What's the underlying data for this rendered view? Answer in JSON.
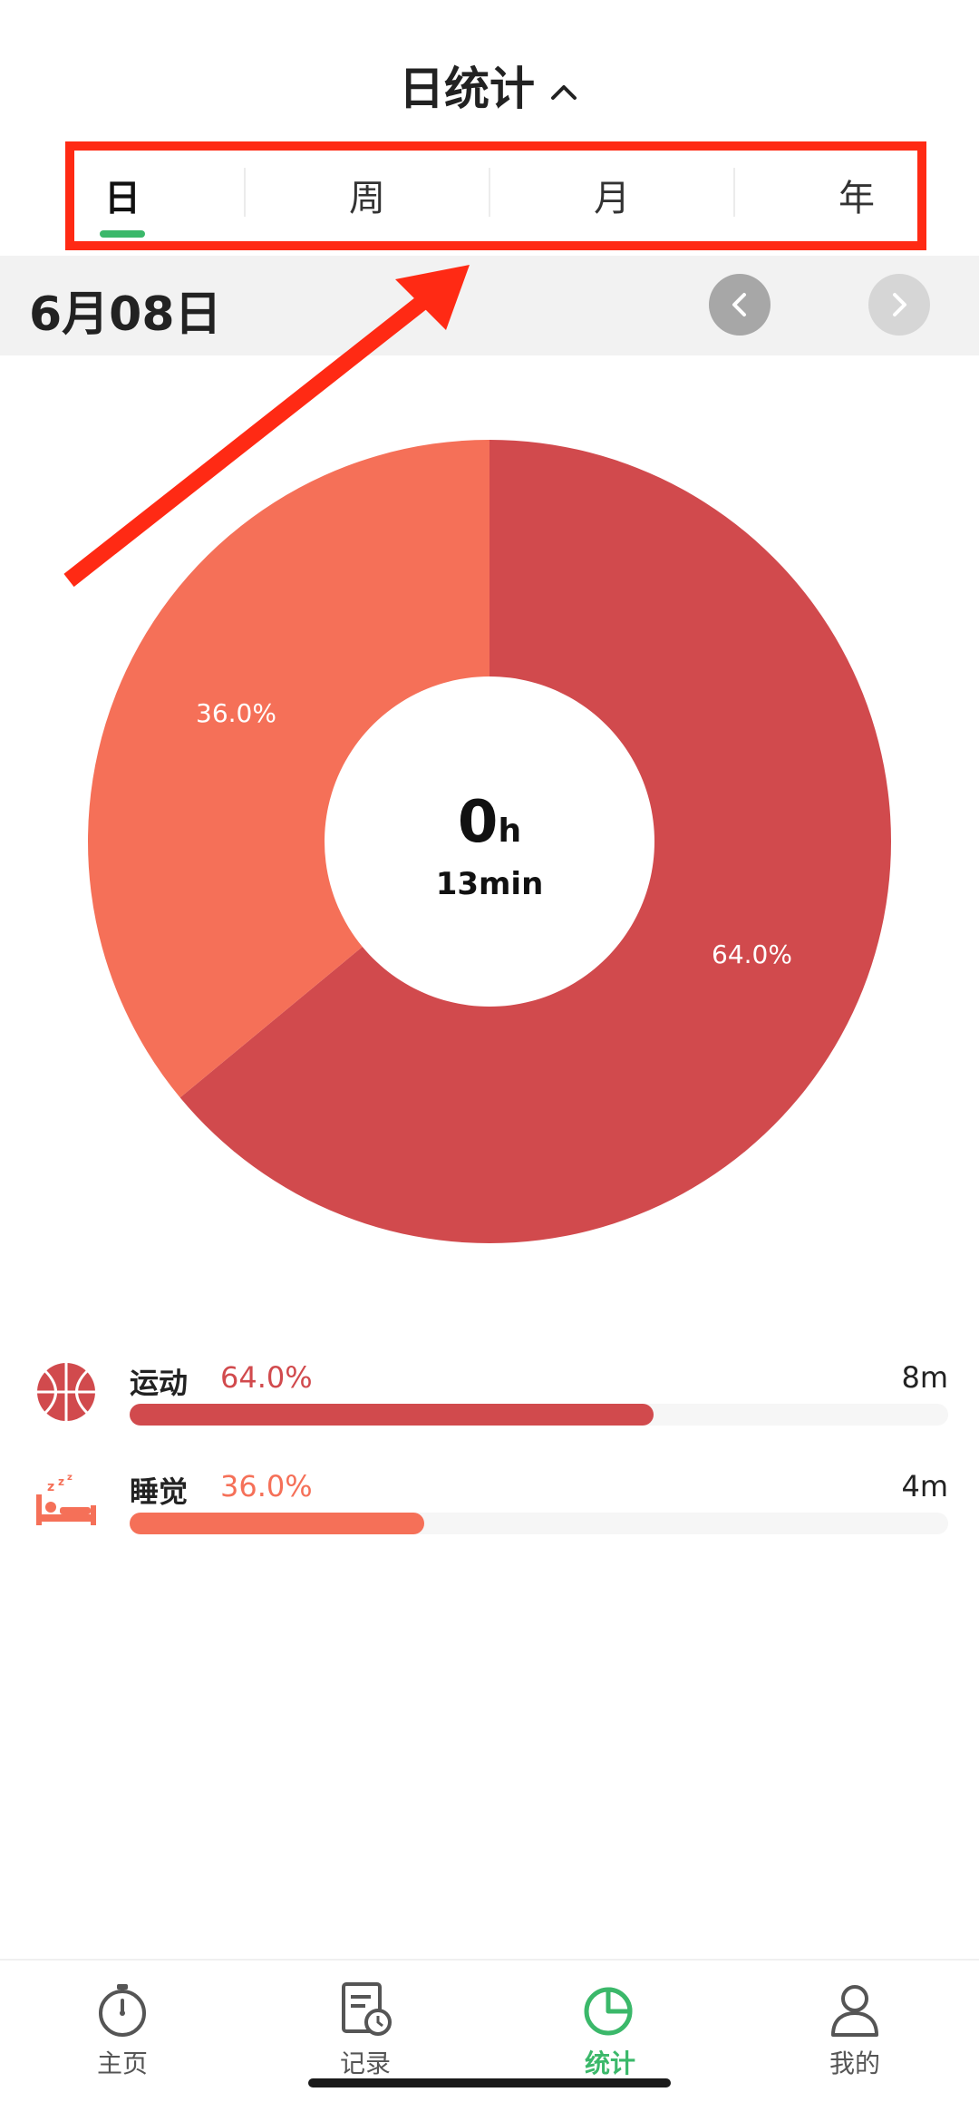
{
  "header": {
    "title": "日统计"
  },
  "tabs": [
    {
      "label": "日",
      "active": true
    },
    {
      "label": "周",
      "active": false
    },
    {
      "label": "月",
      "active": false
    },
    {
      "label": "年",
      "active": false
    }
  ],
  "date_bar": {
    "date": "6月08日"
  },
  "summary": {
    "hours": "0",
    "hours_unit": "h",
    "minutes": "13min"
  },
  "chart_data": {
    "type": "pie",
    "categories": [
      "运动",
      "睡觉"
    ],
    "values": [
      64.0,
      36.0
    ],
    "labels": [
      "64.0%",
      "36.0%"
    ],
    "colors": [
      "#d14a4d",
      "#f57058"
    ],
    "donut": true
  },
  "legend": [
    {
      "name": "运动",
      "percent": "64.0%",
      "value": 0.64,
      "time": "8m",
      "color": "#d14a4d",
      "icon": "basketball-icon"
    },
    {
      "name": "睡觉",
      "percent": "36.0%",
      "value": 0.36,
      "time": "4m",
      "color": "#f57058",
      "icon": "sleep-bed-icon"
    }
  ],
  "bottom_nav": [
    {
      "label": "主页",
      "icon": "stopwatch-icon",
      "active": false
    },
    {
      "label": "记录",
      "icon": "records-icon",
      "active": false
    },
    {
      "label": "统计",
      "icon": "pie-chart-icon",
      "active": true
    },
    {
      "label": "我的",
      "icon": "person-icon",
      "active": false
    }
  ],
  "colors": {
    "accent": "#3bb86a",
    "highlight": "#ff2a14"
  }
}
